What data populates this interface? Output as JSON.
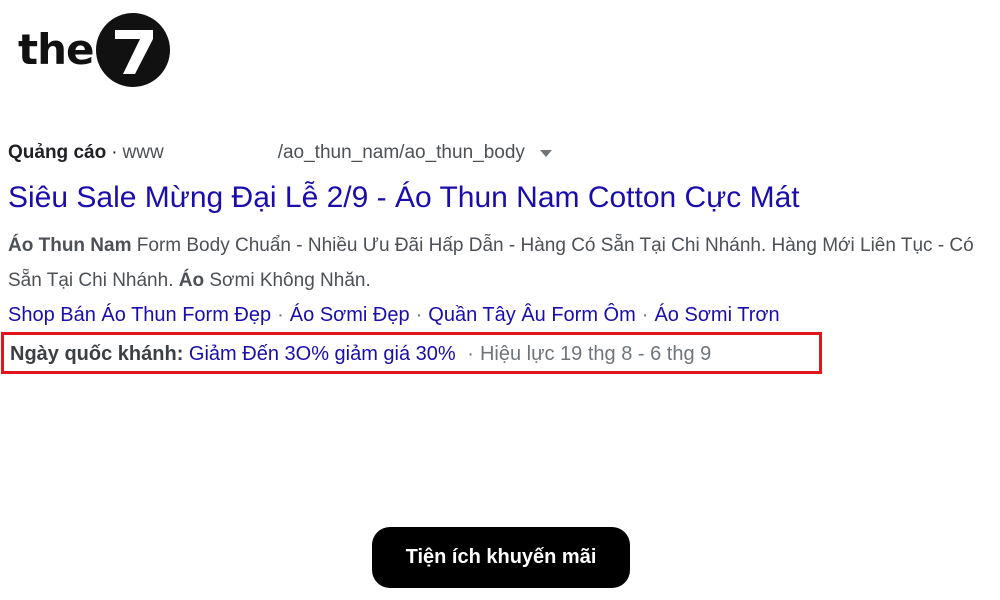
{
  "logo": {
    "word": "the",
    "numeral": "7",
    "colors": {
      "ink": "#111111",
      "paper": "#ffffff"
    }
  },
  "ad": {
    "label": "Quảng cáo",
    "separator": "·",
    "url_prefix": "www",
    "url_suffix": "/ao_thun_nam/ao_thun_body",
    "title": "Siêu Sale Mừng Đại Lễ 2/9 - Áo Thun Nam Cotton Cực Mát",
    "description": {
      "bold1": "Áo Thun Nam",
      "text1": " Form Body Chuẩn - Nhiều Ưu Đãi Hấp Dẫn - Hàng Có Sẵn Tại Chi Nhánh. Hàng Mới Liên Tục - Có Sẵn Tại Chi Nhánh. ",
      "bold2": "Áo",
      "text2": " Sơmi Không Nhăn."
    },
    "sitelinks": [
      "Shop Bán Áo Thun Form Đẹp",
      "Áo Sơmi Đẹp",
      "Quần Tây Âu Form Ôm",
      "Áo Sơmi Trơn"
    ],
    "promotion": {
      "label": "Ngày quốc khánh:",
      "link": "Giảm Đến 3O% giảm giá 30%",
      "separator": "·",
      "validity": "Hiệu lực 19 thg 8 - 6 thg 9"
    },
    "colors": {
      "link": "#1a0dab",
      "highlight_border": "#e3141b",
      "text": "#4d5156"
    }
  },
  "caption": "Tiện ích khuyến mãi"
}
